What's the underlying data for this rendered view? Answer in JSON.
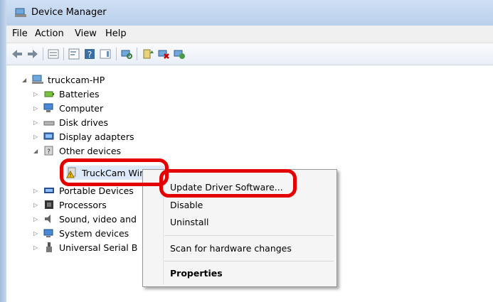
{
  "window": {
    "title": "Device Manager"
  },
  "menu": [
    "File",
    "Action",
    "View",
    "Help"
  ],
  "toolbar": [
    "back-arrow",
    "forward-arrow",
    "properties-pane",
    "show-hide-console-tree",
    "help",
    "action-pane",
    "scan-hardware",
    "update-driver",
    "disable-device",
    "uninstall-device"
  ],
  "tree": {
    "root": "truckcam-HP",
    "items": [
      "Batteries",
      "Computer",
      "Disk drives",
      "Display adapters",
      "Other devices",
      "TruckCam Wireless",
      "Portable Devices",
      "Processors",
      "Sound, video and",
      "System devices",
      "Universal Serial B"
    ]
  },
  "context_menu": {
    "items": [
      "Update Driver Software...",
      "Disable",
      "Uninstall",
      "Scan for hardware changes",
      "Properties"
    ]
  },
  "colors": {
    "highlight_outline": "#e40000",
    "titlebar": "#c4d8ef"
  }
}
